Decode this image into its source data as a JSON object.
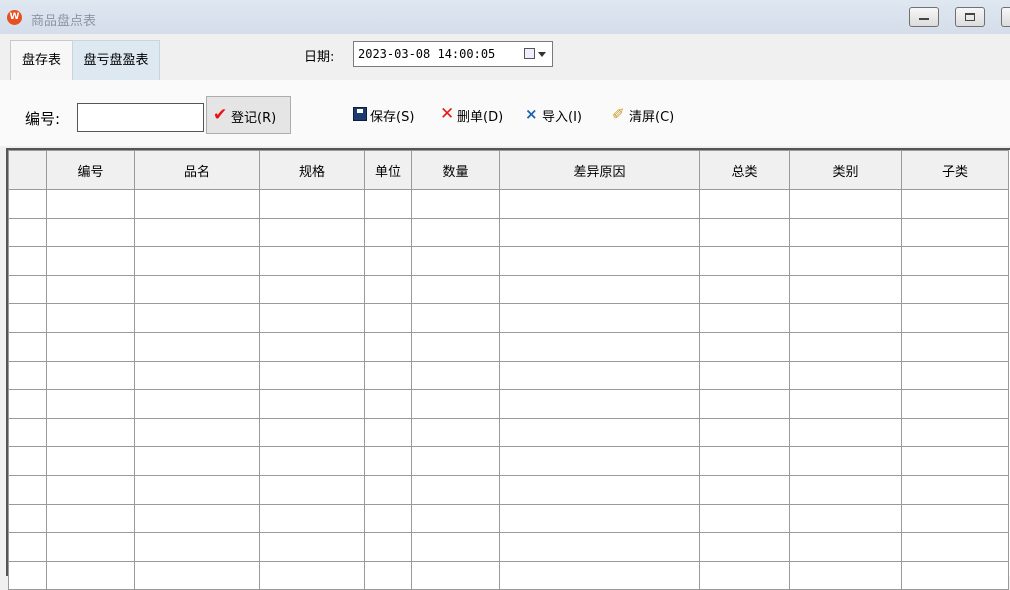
{
  "window": {
    "title": "商品盘点表",
    "app_icon_letter": "W",
    "accent_color": "#e8501f"
  },
  "tabs": [
    {
      "label": "盘存表",
      "active": true
    },
    {
      "label": "盘亏盘盈表",
      "active": false
    }
  ],
  "date": {
    "label": "日期:",
    "value": "2023-03-08 14:00:05"
  },
  "code_field": {
    "label": "编号:",
    "value": ""
  },
  "toolbar": {
    "register_label": "登记(R)",
    "save_label": "保存(S)",
    "delete_label": "删单(D)",
    "import_label": "导入(I)",
    "clear_label": "清屏(C)"
  },
  "table": {
    "columns": [
      "",
      "编号",
      "品名",
      "规格",
      "单位",
      "数量",
      "差异原因",
      "总类",
      "类别",
      "子类"
    ],
    "row_count": 14
  }
}
